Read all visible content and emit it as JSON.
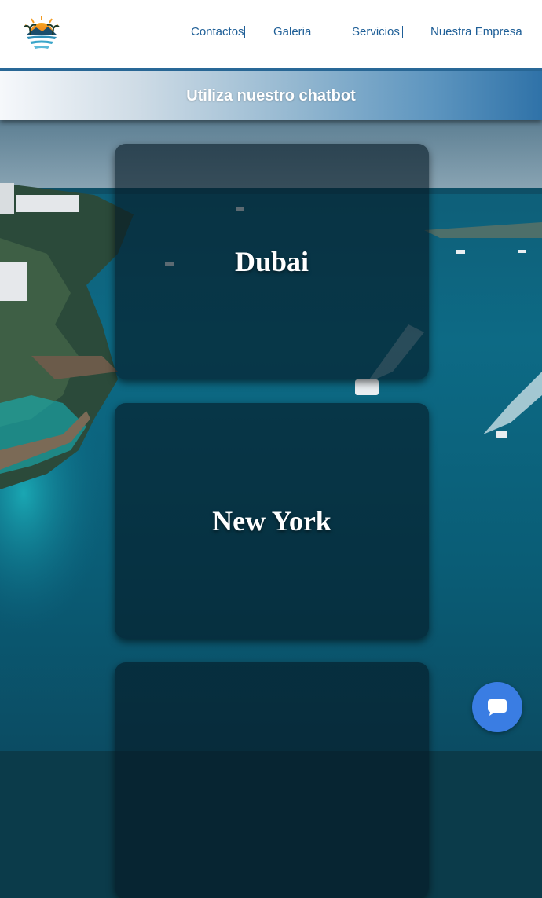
{
  "header": {
    "logo_icon": "sunset-island-logo-icon",
    "nav": [
      {
        "label": "Contactos"
      },
      {
        "label": "Galeria"
      },
      {
        "label": "Servicios"
      },
      {
        "label": "Nuestra Empresa"
      }
    ]
  },
  "banner": {
    "label": "Utiliza nuestro chatbot"
  },
  "destinations": [
    {
      "name": "Dubai"
    },
    {
      "name": "New York"
    },
    {
      "name": ""
    }
  ],
  "chat": {
    "icon": "chat-bubble-icon"
  },
  "colors": {
    "nav_text": "#1f5f97",
    "header_border": "#2a6a9a",
    "chat_button": "#3a7de3"
  }
}
